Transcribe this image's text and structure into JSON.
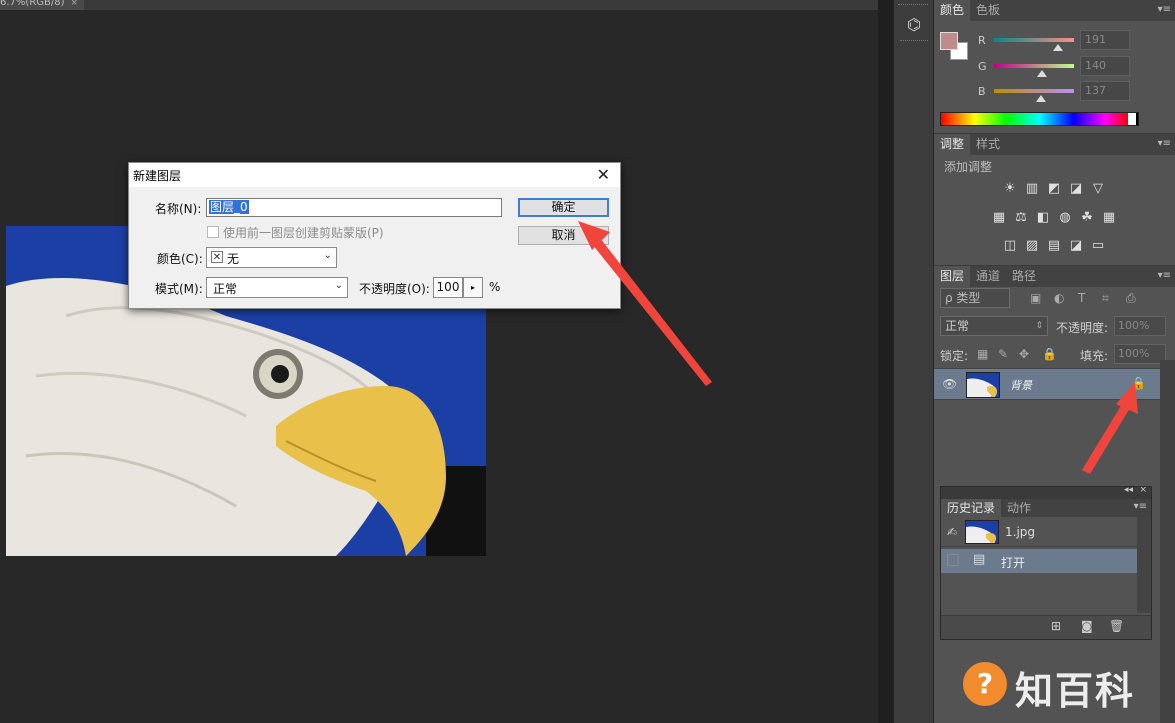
{
  "document": {
    "tab_label": "6.7%(RGB/8)",
    "tab_close": "×"
  },
  "color_panel": {
    "tabs": [
      "颜色",
      "色板"
    ],
    "menu": "▾≡",
    "sliders": [
      {
        "label": "R",
        "value": "191"
      },
      {
        "label": "G",
        "value": "140"
      },
      {
        "label": "B",
        "value": "137"
      }
    ],
    "foreground_color": "#bf8c89",
    "background_color": "#ffffff"
  },
  "adjustments_panel": {
    "tabs": [
      "调整",
      "样式"
    ],
    "menu": "▾≡",
    "add_label": "添加调整",
    "row1": [
      "☀",
      "▥",
      "◩",
      "◪",
      "▽"
    ],
    "row2": [
      "▦",
      "⚖",
      "◧",
      "◍",
      "☘",
      "▦"
    ],
    "row3": [
      "◫",
      "▨",
      "▤",
      "◪",
      "▭"
    ]
  },
  "layers_panel": {
    "tabs": [
      "图层",
      "通道",
      "路径"
    ],
    "menu": "▾≡",
    "filter_label": "ρ 类型",
    "filter_icons": [
      "▣",
      "◐",
      "T",
      "⌗",
      "⎙"
    ],
    "blend_mode": "正常",
    "opacity_label": "不透明度:",
    "opacity_value": "100%",
    "lock_label": "锁定:",
    "lock_icons": [
      "▦",
      "✎",
      "✥",
      "🔒"
    ],
    "fill_label": "填充:",
    "fill_value": "100%",
    "layer": {
      "name": "背景",
      "eye": "👁",
      "lock": "🔒"
    }
  },
  "history_panel": {
    "controls": [
      "◂◂",
      "×"
    ],
    "tabs": [
      "历史记录",
      "动作"
    ],
    "menu": "▾≡",
    "snapshot": "1.jpg",
    "items": [
      {
        "name": "打开"
      }
    ],
    "footer_icons": [
      "⊞",
      "◙",
      "🗑"
    ]
  },
  "dialog": {
    "title": "新建图层",
    "close": "✕",
    "name_label": "名称(N):",
    "name_value": "图层_0",
    "clip_label": "使用前一图层创建剪贴蒙版(P)",
    "color_label": "颜色(C):",
    "color_value": "无",
    "mode_label": "模式(M):",
    "mode_value": "正常",
    "opacity_label": "不透明度(O):",
    "opacity_value": "100",
    "opacity_step": "▸",
    "percent": "%",
    "ok_label": "确定",
    "cancel_label": "取消"
  },
  "watermark": {
    "logo": "?",
    "text": "知百科"
  },
  "colors": {
    "annotation_arrow": "#f0453d",
    "selection": "#3372d3",
    "layer_selected": "#6b7a8c"
  }
}
